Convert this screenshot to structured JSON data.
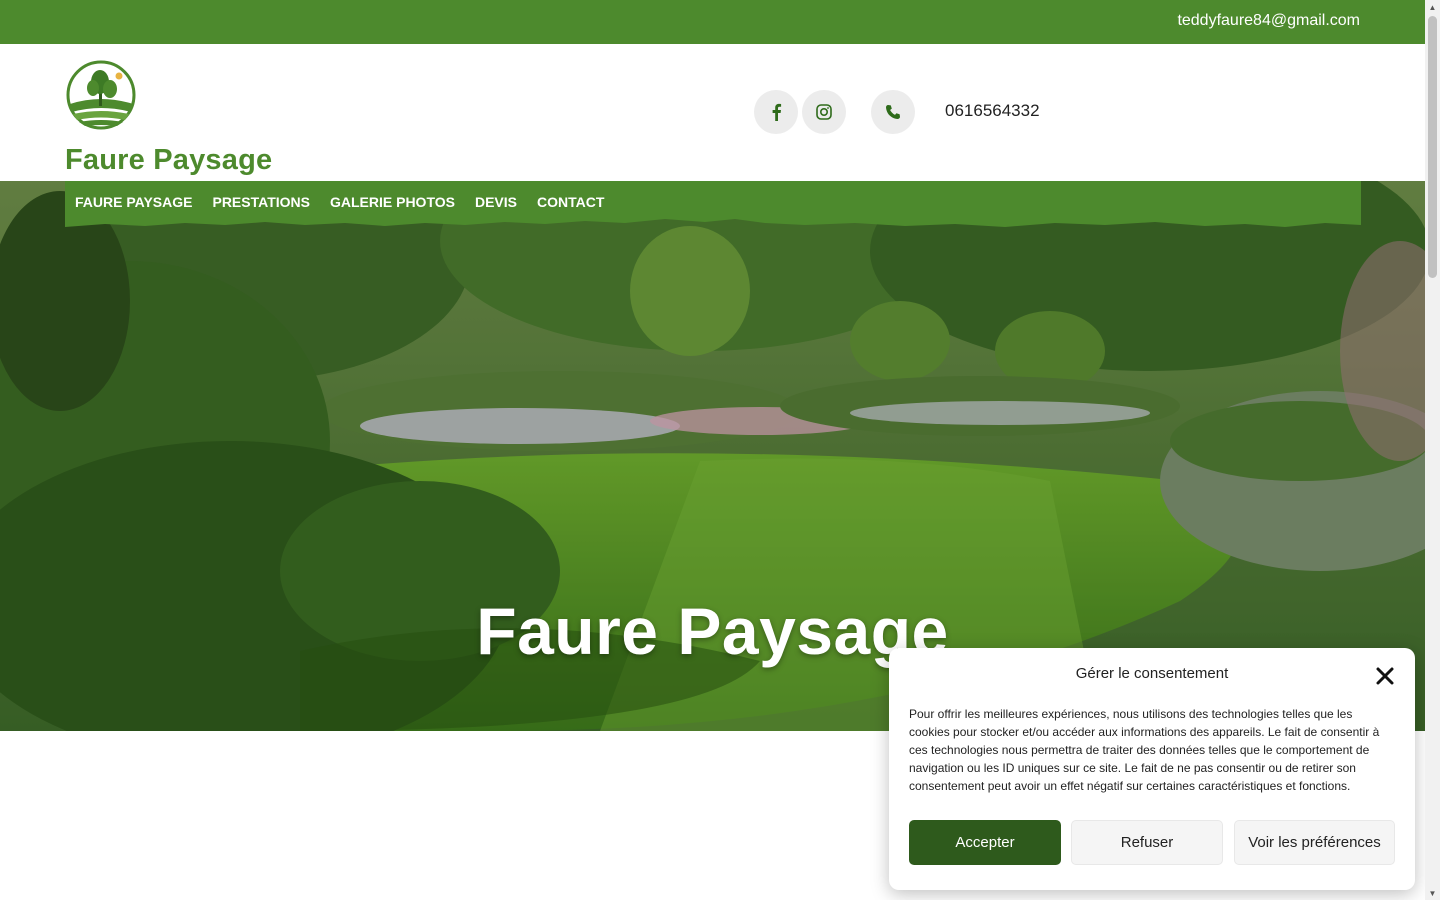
{
  "topbar": {
    "email": "teddyfaure84@gmail.com"
  },
  "header": {
    "logo_text": "Faure Paysage",
    "phone": "0616564332",
    "icons": [
      "facebook-icon",
      "instagram-icon",
      "phone-icon"
    ]
  },
  "nav": {
    "items": [
      {
        "label": "FAURE PAYSAGE"
      },
      {
        "label": "PRESTATIONS"
      },
      {
        "label": "GALERIE PHOTOS"
      },
      {
        "label": "DEVIS"
      },
      {
        "label": "CONTACT"
      }
    ]
  },
  "hero": {
    "title": "Faure Paysage"
  },
  "consent": {
    "title": "Gérer le consentement",
    "text": "Pour offrir les meilleures expériences, nous utilisons des technologies telles que les cookies pour stocker et/ou accéder aux informations des appareils. Le fait de consentir à ces technologies nous permettra de traiter des données telles que le comportement de navigation ou les ID uniques sur ce site. Le fait de ne pas consentir ou de retirer son consentement peut avoir un effet négatif sur certaines caractéristiques et fonctions.",
    "accept_label": "Accepter",
    "refuse_label": "Refuser",
    "prefs_label": "Voir les préférences"
  },
  "colors": {
    "brand_green": "#4d8a2d",
    "accept_green": "#2e5a1c"
  }
}
